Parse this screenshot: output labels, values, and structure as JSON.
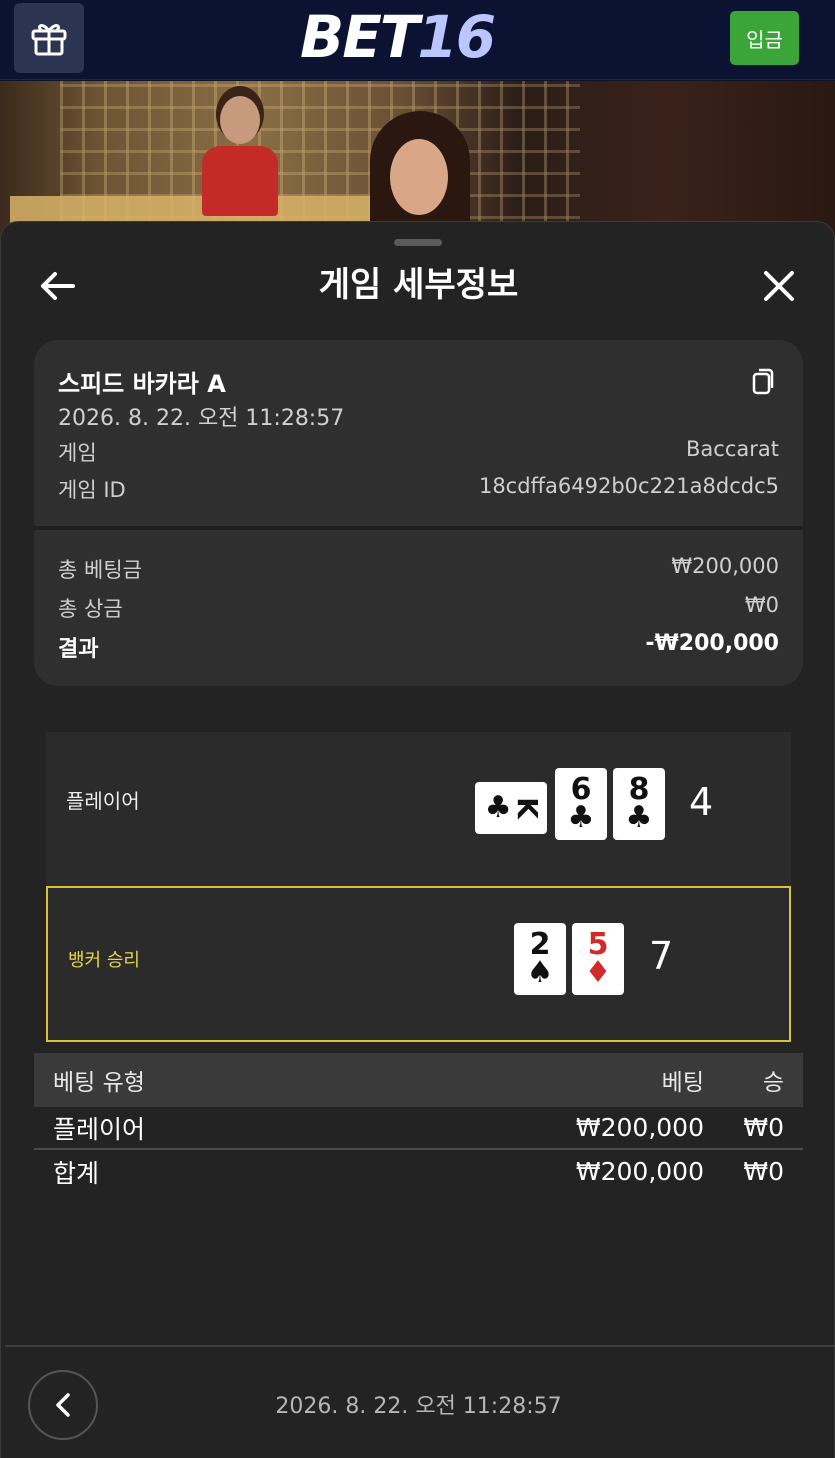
{
  "header": {
    "logo_bet": "BET",
    "logo_num": "16",
    "deposit_label": "입금"
  },
  "sheet": {
    "title": "게임 세부정보"
  },
  "info": {
    "game_name": "스피드 바카라 A",
    "game_time": "2026. 8. 22. 오전 11:28:57",
    "rows": [
      {
        "label": "게임",
        "value": "Baccarat"
      },
      {
        "label": "게임 ID",
        "value": "18cdffa6492b0c221a8dcdc5"
      }
    ],
    "totals": [
      {
        "label": "총 베팅금",
        "value": "₩200,000"
      },
      {
        "label": "총 상금",
        "value": "₩0"
      },
      {
        "label": "결과",
        "value": "-₩200,000"
      }
    ]
  },
  "rounds": {
    "player": {
      "label": "플레이어",
      "score": "4",
      "cards": [
        {
          "rank": "K",
          "suit": "♣",
          "color": "#111111",
          "orientation": "sideways"
        },
        {
          "rank": "6",
          "suit": "♣",
          "color": "#111111",
          "orientation": "upright"
        },
        {
          "rank": "8",
          "suit": "♣",
          "color": "#111111",
          "orientation": "upright"
        }
      ]
    },
    "banker": {
      "label": "뱅커 승리",
      "score": "7",
      "highlight_color": "#d8c23a",
      "cards": [
        {
          "rank": "2",
          "suit": "♠",
          "color": "#111111",
          "orientation": "upright"
        },
        {
          "rank": "5",
          "suit": "♦",
          "color": "#d02a2a",
          "orientation": "upright"
        }
      ]
    }
  },
  "bets": {
    "headers": [
      "베팅 유형",
      "베팅",
      "승"
    ],
    "rows": [
      {
        "type": "플레이어",
        "bet": "₩200,000",
        "win": "₩0"
      }
    ],
    "total": {
      "type": "합계",
      "bet": "₩200,000",
      "win": "₩0"
    }
  },
  "footer": {
    "time": "2026. 8. 22. 오전 11:28:57"
  },
  "colors": {
    "deposit_green": "#3ca53a",
    "header_bg": "#0b1232",
    "sheet_bg": "#232323",
    "winner_outline": "#d8c23a"
  },
  "icons": [
    "gift-icon",
    "back-arrow-icon",
    "close-icon",
    "copy-icon",
    "chevron-left-icon"
  ]
}
